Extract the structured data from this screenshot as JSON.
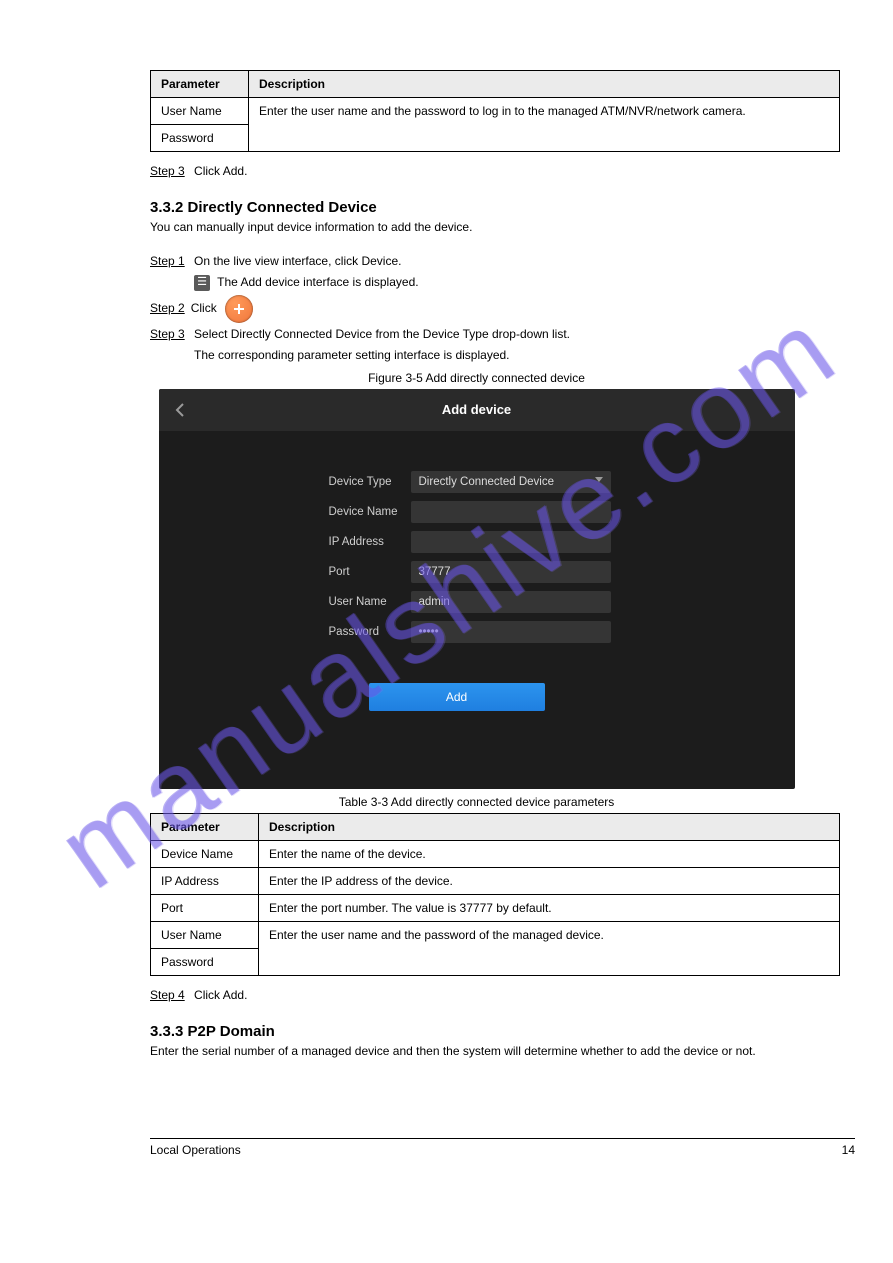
{
  "table1": {
    "headers": [
      "Parameter",
      "Description"
    ],
    "rows": [
      {
        "p": "User Name",
        "d": "Enter the user name and the password to log in to the managed ATM/NVR/network camera."
      },
      {
        "p": "Password",
        "d": ""
      }
    ]
  },
  "step3_label": "Step 3",
  "step3_text": "Click Add.",
  "section2": {
    "title": "3.3.2 Directly Connected Device",
    "desc": "You can manually input device information to add the device."
  },
  "step1_label": "Step 1",
  "step1_text1": "On the live view interface, click Device.",
  "step1_text2": "The Add device interface is displayed.",
  "step2a_label": "Step 2",
  "step2a_text": "Click",
  "step2b_label": "Step 3",
  "step2b_text": "Select Directly Connected Device from the Device Type drop-down list.",
  "step2b_text2": "The corresponding parameter setting interface is displayed.",
  "fig_caption": "Figure 3-5 Add directly connected device",
  "shot": {
    "title": "Add device",
    "rows": [
      {
        "label": "Device Type",
        "value": "Directly Connected Device",
        "type": "select"
      },
      {
        "label": "Device Name",
        "value": "",
        "type": "text"
      },
      {
        "label": "IP Address",
        "value": "",
        "type": "text"
      },
      {
        "label": "Port",
        "value": "37777",
        "type": "text"
      },
      {
        "label": "User Name",
        "value": "admin",
        "type": "text"
      },
      {
        "label": "Password",
        "value": "•••••",
        "type": "password"
      }
    ],
    "add_btn": "Add"
  },
  "tbl2_caption": "Table 3-3 Add directly connected device parameters",
  "table2": {
    "headers": [
      "Parameter",
      "Description"
    ],
    "rows": [
      {
        "p": "Device Name",
        "d": "Enter the name of the device."
      },
      {
        "p": "IP Address",
        "d": "Enter the IP address of the device."
      },
      {
        "p": "Port",
        "d": "Enter the port number. The value is 37777 by default."
      },
      {
        "p": "User Name",
        "d": "Enter the user name and the password of the managed device."
      },
      {
        "p": "Password",
        "d": ""
      }
    ]
  },
  "step4_label": "Step 4",
  "step4_text": "Click Add.",
  "section3": {
    "title": "3.3.3 P2P Domain",
    "desc": "Enter the serial number of a managed device and then the system will determine whether to add the device or not."
  },
  "footer": {
    "left": "Local Operations",
    "right": "14"
  },
  "watermark": "manualshive.com"
}
